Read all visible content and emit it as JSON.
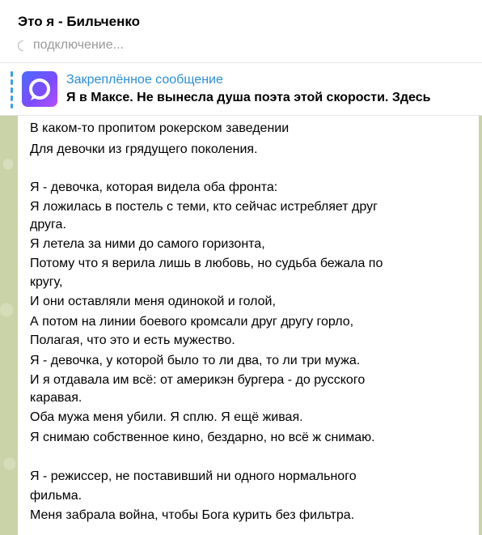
{
  "header": {
    "title": "Это я - Бильченко",
    "status": "подключение..."
  },
  "pinned": {
    "title": "Закреплённое сообщение",
    "text": "Я в Максе. Не вынесла душа поэта этой скорости. Здесь"
  },
  "message": {
    "lines": [
      "В каком-то пропитом рокерском заведении",
      "Для девочки из грядущего поколения.",
      "",
      "Я - девочка, которая видела оба фронта:",
      "Я ложилась в постель с теми, кто сейчас истребляет друг",
      "друга.",
      "Я летела за ними до самого горизонта,",
      "Потому что я верила лишь в любовь, но судьба бежала по",
      "кругу,",
      "И они оставляли меня одинокой и голой,",
      "А потом на линии боевого кромсали друг другу горло,",
      "Полагая, что это и есть мужество.",
      "Я - девочка, у которой было то ли два, то ли три мужа.",
      "И я отдавала им всё: от америкэн бургера - до русского",
      "каравая.",
      "Оба мужа меня убили. Я сплю. Я ещё живая.",
      "Я снимаю собственное кино, бездарно, но всё ж снимаю.",
      "",
      "Я - режиссер, не поставивший ни одного нормального",
      "фильма.",
      "Меня забрала война, чтобы Бога курить без фильтра."
    ]
  },
  "colors": {
    "accent": "#2b8ed6",
    "chat_background": "#c9d3a7",
    "status_text": "#999999"
  },
  "icons": {
    "pinned_thumbnail": "max-app-logo-icon",
    "status": "spinner-icon"
  }
}
